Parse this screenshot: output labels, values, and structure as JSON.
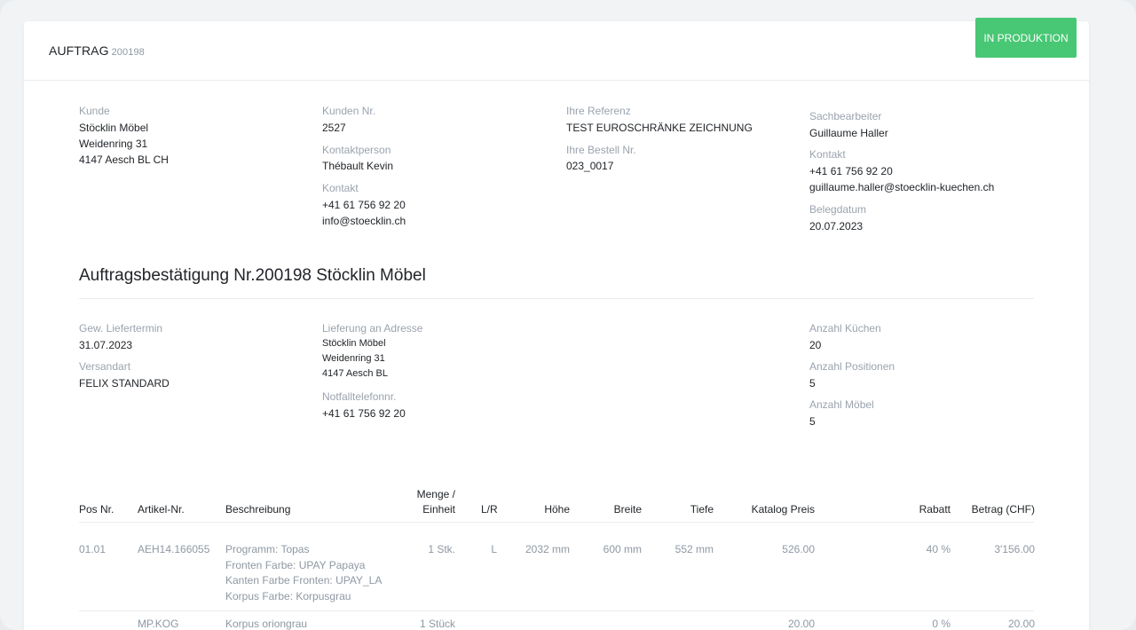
{
  "header": {
    "title": "AUFTRAG",
    "order_number": "200198",
    "status": "IN PRODUKTION"
  },
  "customer": {
    "label": "Kunde",
    "lines": [
      "Stöcklin Möbel",
      "Weidenring 31",
      "4147 Aesch BL CH"
    ]
  },
  "customer_info": {
    "number_label": "Kunden Nr.",
    "number": "2527",
    "contact_person_label": "Kontaktperson",
    "contact_person": "Thébault Kevin",
    "contact_label": "Kontakt",
    "phone": "+41 61 756 92 20",
    "email": "info@stoecklin.ch"
  },
  "reference": {
    "ref_label": "Ihre Referenz",
    "ref_value": "TEST EUROSCHRÄNKE ZEICHNUNG",
    "order_no_label": "Ihre Bestell Nr.",
    "order_no": "023_0017"
  },
  "clerk": {
    "label": "Sachbearbeiter",
    "name": "Guillaume Haller",
    "contact_label": "Kontakt",
    "phone": "+41 61 756 92 20",
    "email": "guillaume.haller@stoecklin-kuechen.ch",
    "date_label": "Belegdatum",
    "date": "20.07.2023"
  },
  "confirmation": {
    "title": "Auftragsbestätigung Nr.200198 Stöcklin Möbel"
  },
  "delivery": {
    "date_label": "Gew. Liefertermin",
    "date": "31.07.2023",
    "shipping_label": "Versandart",
    "shipping": "FELIX STANDARD",
    "address_label": "Lieferung an Adresse",
    "address_lines": [
      "Stöcklin Möbel",
      "Weidenring 31",
      "4147 Aesch BL"
    ],
    "emergency_label": "Notfalltelefonnr.",
    "emergency_phone": "+41 61 756 92 20"
  },
  "counts": {
    "kitchens_label": "Anzahl Küchen",
    "kitchens": "20",
    "positions_label": "Anzahl Positionen",
    "positions": "5",
    "furniture_label": "Anzahl Möbel",
    "furniture": "5"
  },
  "table": {
    "headers": {
      "pos": "Pos Nr.",
      "article": "Artikel-Nr.",
      "desc": "Beschreibung",
      "qty_line1": "Menge /",
      "qty_line2": "Einheit",
      "lr": "L/R",
      "height": "Höhe",
      "width": "Breite",
      "depth": "Tiefe",
      "price": "Katalog Preis",
      "discount": "Rabatt",
      "amount": "Betrag (CHF)"
    },
    "rows": [
      {
        "pos": "01.01",
        "article": "AEH14.166055",
        "desc": [
          "Programm: Topas",
          "Fronten Farbe: UPAY Papaya",
          "Kanten Farbe Fronten: UPAY_LA",
          "Korpus Farbe: Korpusgrau"
        ],
        "qty": "1 Stk.",
        "lr": "L",
        "height": "2032 mm",
        "width": "600 mm",
        "depth": "552 mm",
        "price": "526.00",
        "discount": "40 %",
        "amount": "3'156.00"
      },
      {
        "pos": "",
        "article": "MP.KOG",
        "desc": [
          "Korpus oriongrau"
        ],
        "qty": "1 Stück",
        "lr": "",
        "height": "",
        "width": "",
        "depth": "",
        "price": "20.00",
        "discount": "0 %",
        "amount": "20.00"
      }
    ]
  }
}
